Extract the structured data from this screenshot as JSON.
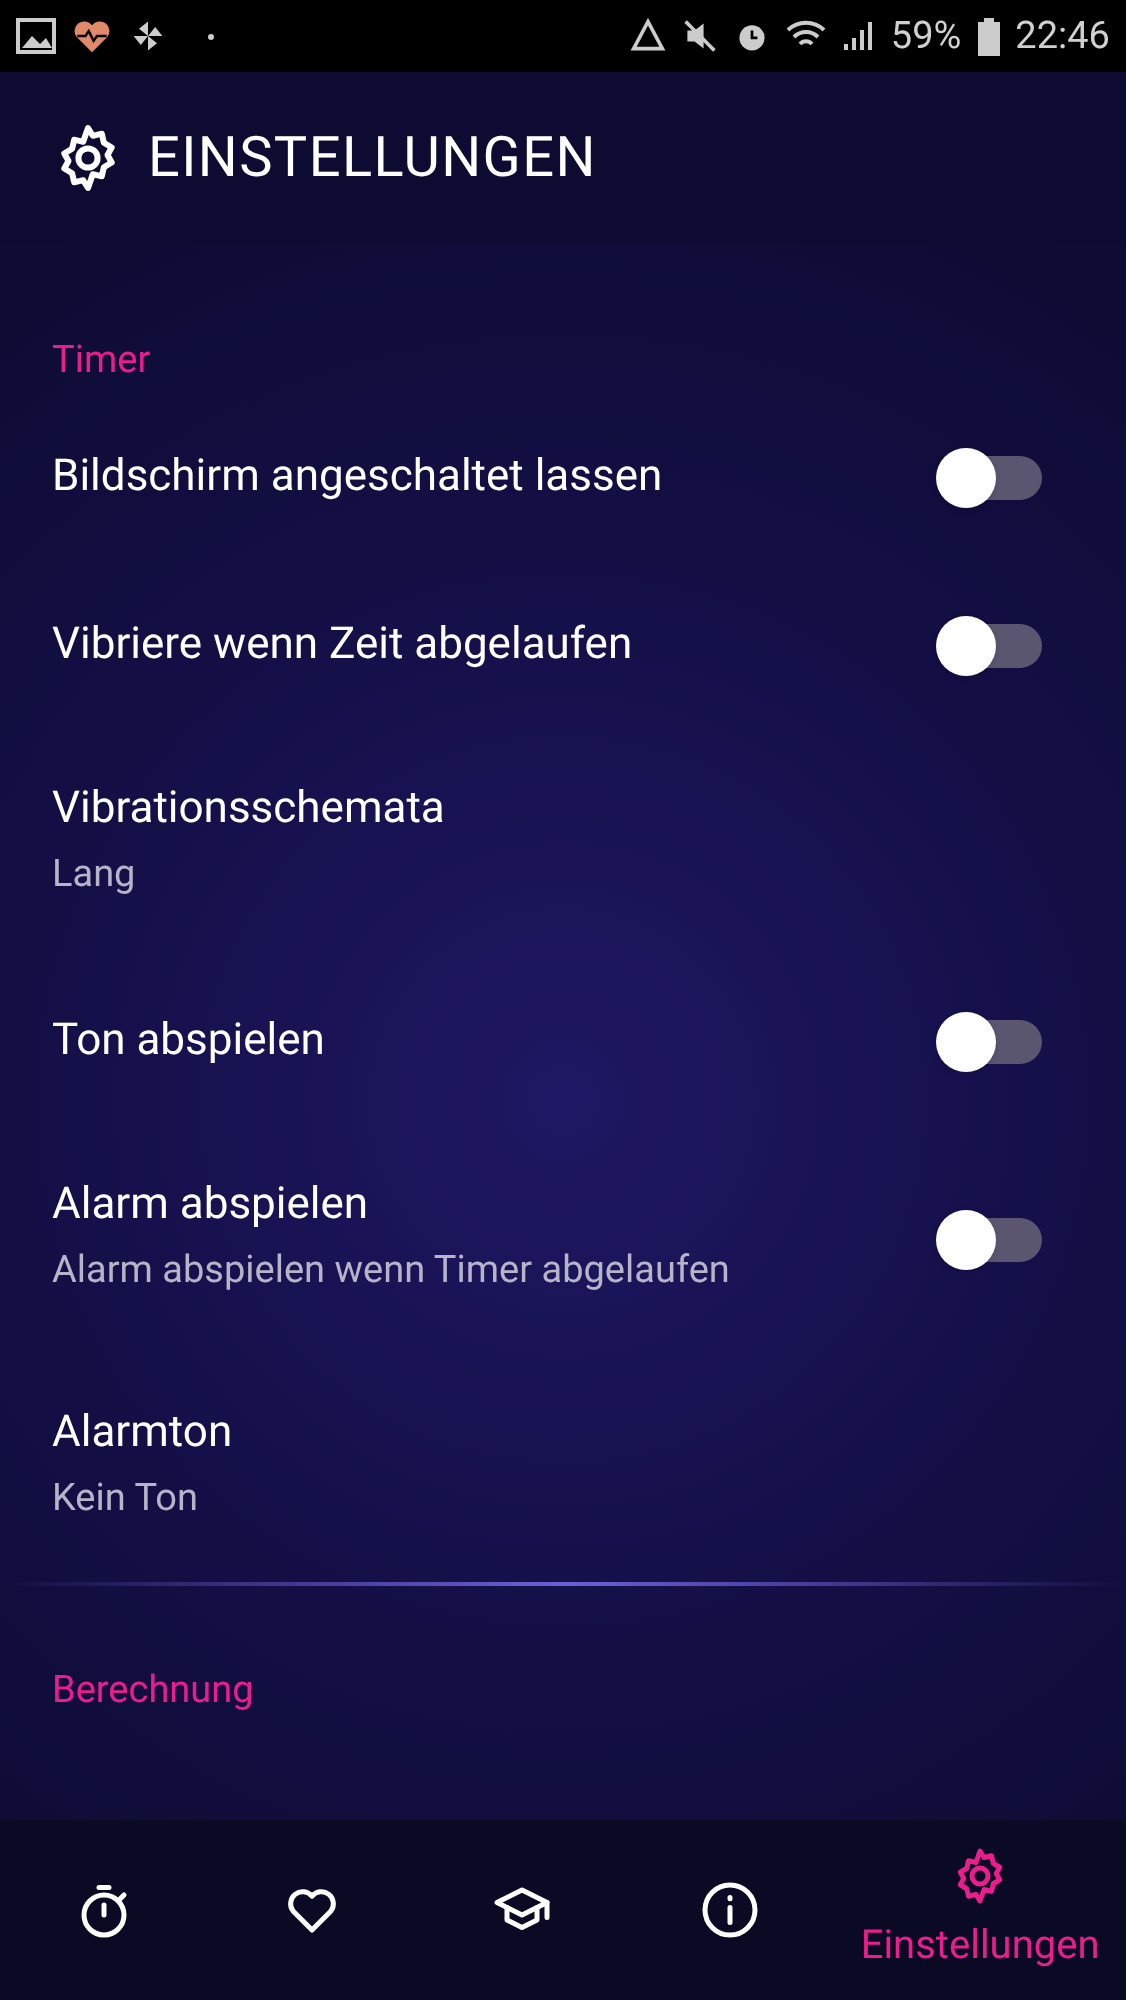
{
  "status_bar": {
    "battery": "59%",
    "time": "22:46"
  },
  "header": {
    "title": "EINSTELLUNGEN"
  },
  "sections": [
    {
      "title": "Timer",
      "items": [
        {
          "kind": "toggle",
          "title": "Bildschirm angeschaltet lassen",
          "on": false
        },
        {
          "kind": "toggle",
          "title": "Vibriere wenn Zeit abgelaufen",
          "on": false
        },
        {
          "kind": "choice",
          "title": "Vibrationsschemata",
          "subtitle": "Lang"
        },
        {
          "kind": "toggle",
          "title": "Ton abspielen",
          "on": false
        },
        {
          "kind": "toggle",
          "title": "Alarm abspielen",
          "subtitle": "Alarm abspielen wenn Timer abgelaufen",
          "on": false
        },
        {
          "kind": "choice",
          "title": "Alarmton",
          "subtitle": "Kein Ton"
        }
      ]
    },
    {
      "title": "Berechnung"
    }
  ],
  "bottom_nav": [
    {
      "selected": false
    },
    {
      "selected": false
    },
    {
      "selected": false
    },
    {
      "selected": false
    },
    {
      "selected": true,
      "label": "Einstellungen"
    }
  ]
}
